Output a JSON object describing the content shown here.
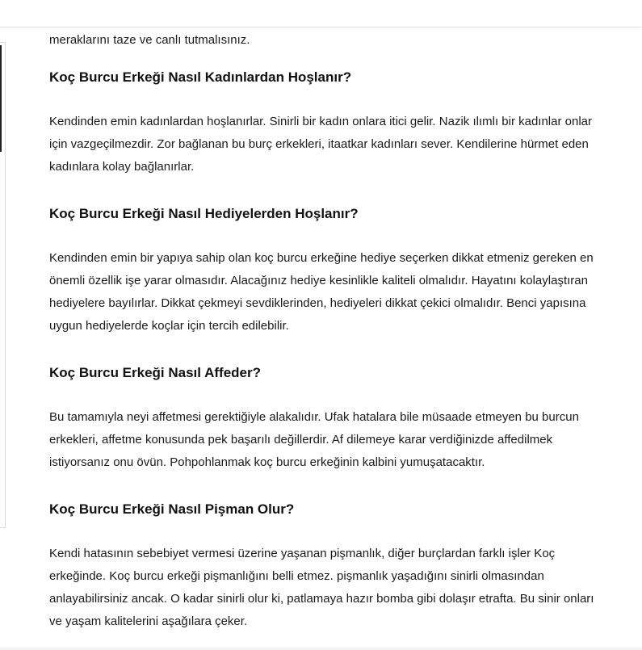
{
  "article": {
    "lead": "meraklarını taze ve canlı tutmalısınız.",
    "sections": [
      {
        "heading": "Koç Burcu Erkeği Nasıl Kadınlardan Hoşlanır?",
        "text": "Kendinden emin kadınlardan hoşlanırlar. Sinirli bir kadın onlara itici gelir. Nazik ılımlı bir kadınlar onlar için vazgeçilmezdir. Zor bağlanan bu burç erkekleri, itaatkar kadınları sever. Kendilerine hürmet eden kadınlara kolay bağlanırlar."
      },
      {
        "heading": "Koç Burcu Erkeği Nasıl Hediyelerden Hoşlanır?",
        "text": "Kendinden emin bir yapıya sahip olan koç burcu erkeğine hediye seçerken dikkat etmeniz gereken en önemli özellik işe yarar olmasıdır. Alacağınız hediye kesinlikle kaliteli olmalıdır. Hayatını kolaylaştıran hediyelere bayılırlar. Dikkat çekmeyi sevdiklerinden, hediyeleri dikkat çekici olmalıdır. Benci yapısına uygun hediyelerde koçlar için tercih edilebilir."
      },
      {
        "heading": "Koç Burcu Erkeği Nasıl Affeder?",
        "text": "Bu tamamıyla neyi affetmesi gerektiğiyle alakalıdır. Ufak hatalara bile müsaade etmeyen bu burcun erkekleri, affetme konusunda pek başarılı değillerdir. Af dilemeye karar verdiğinizde affedilmek istiyorsanız onu övün. Pohpohlanmak koç burcu erkeğinin kalbini yumuşatacaktır."
      },
      {
        "heading": "Koç Burcu Erkeği Nasıl Pişman Olur?",
        "text": "Kendi hatasının sebebiyet vermesi üzerine yaşanan pişmanlık, diğer burçlardan farklı işler Koç erkeğinde. Koç burcu erkeği pişmanlığını belli etmez. pişmanlık yaşadığını sinirli olmasından anlayabilirsiniz ancak. O kadar sinirli olur ki, patlamaya hazır bomba gibi dolaşır etrafta. Bu sinir onları ve yaşam kalitelerini aşağılara çeker."
      }
    ]
  }
}
